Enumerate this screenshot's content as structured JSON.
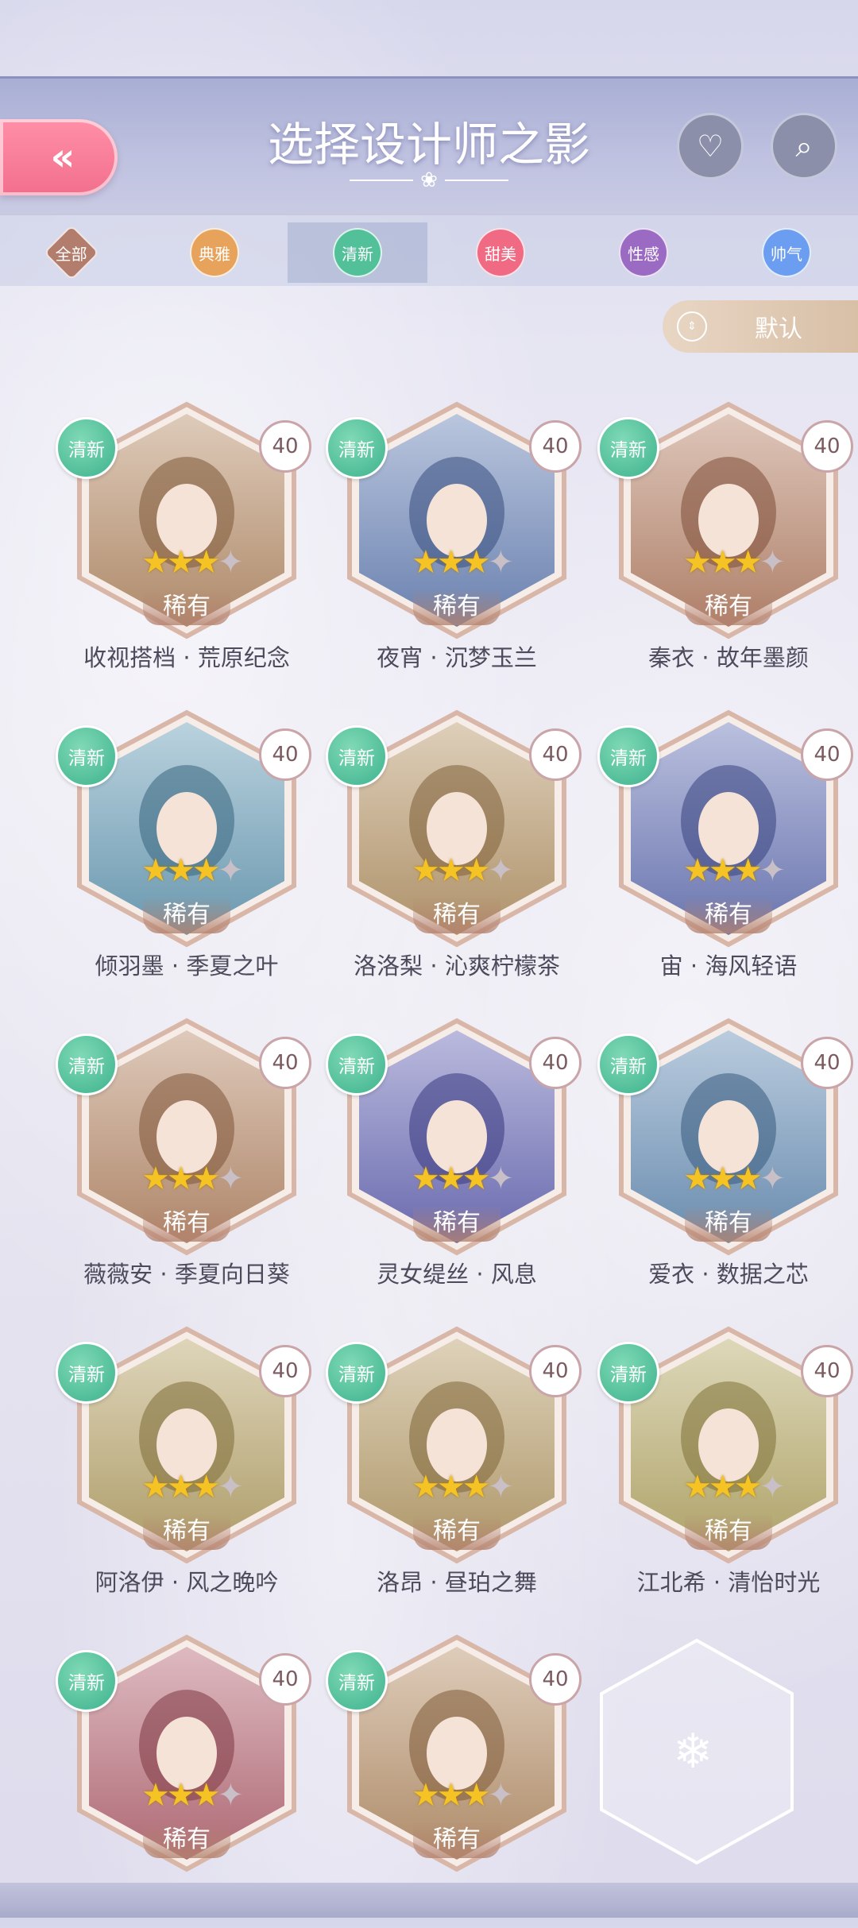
{
  "header": {
    "title": "选择设计师之影"
  },
  "filters": [
    {
      "label": "全部",
      "color": "#b37d6d",
      "shape": "diamond"
    },
    {
      "label": "典雅",
      "color": "#e7a35b"
    },
    {
      "label": "清新",
      "color": "#52c19a",
      "active": true
    },
    {
      "label": "甜美",
      "color": "#f06a84"
    },
    {
      "label": "性感",
      "color": "#9b6ac2"
    },
    {
      "label": "帅气",
      "color": "#6b9ef0"
    }
  ],
  "sort": {
    "label": "默认"
  },
  "cards": [
    {
      "tag": "清新",
      "level": "40",
      "stars": 3,
      "rarity": "稀有",
      "name": "收视搭档 · 荒原纪念"
    },
    {
      "tag": "清新",
      "level": "40",
      "stars": 3,
      "rarity": "稀有",
      "name": "夜宵 · 沉梦玉兰"
    },
    {
      "tag": "清新",
      "level": "40",
      "stars": 3,
      "rarity": "稀有",
      "name": "秦衣 · 故年墨颜"
    },
    {
      "tag": "清新",
      "level": "40",
      "stars": 3,
      "rarity": "稀有",
      "name": "倾羽墨 · 季夏之叶"
    },
    {
      "tag": "清新",
      "level": "40",
      "stars": 3,
      "rarity": "稀有",
      "name": "洛洛梨 · 沁爽柠檬茶"
    },
    {
      "tag": "清新",
      "level": "40",
      "stars": 3,
      "rarity": "稀有",
      "name": "宙 · 海风轻语"
    },
    {
      "tag": "清新",
      "level": "40",
      "stars": 3,
      "rarity": "稀有",
      "name": "薇薇安 · 季夏向日葵"
    },
    {
      "tag": "清新",
      "level": "40",
      "stars": 3,
      "rarity": "稀有",
      "name": "灵女缇丝 · 风息"
    },
    {
      "tag": "清新",
      "level": "40",
      "stars": 3,
      "rarity": "稀有",
      "name": "爱衣 · 数据之芯"
    },
    {
      "tag": "清新",
      "level": "40",
      "stars": 3,
      "rarity": "稀有",
      "name": "阿洛伊 · 风之晚吟"
    },
    {
      "tag": "清新",
      "level": "40",
      "stars": 3,
      "rarity": "稀有",
      "name": "洛昂 · 昼珀之舞"
    },
    {
      "tag": "清新",
      "level": "40",
      "stars": 3,
      "rarity": "稀有",
      "name": "江北希 · 清怡时光"
    },
    {
      "tag": "清新",
      "level": "40",
      "stars": 3,
      "rarity": "稀有",
      "name": ""
    },
    {
      "tag": "清新",
      "level": "40",
      "stars": 3,
      "rarity": "稀有",
      "name": ""
    }
  ]
}
